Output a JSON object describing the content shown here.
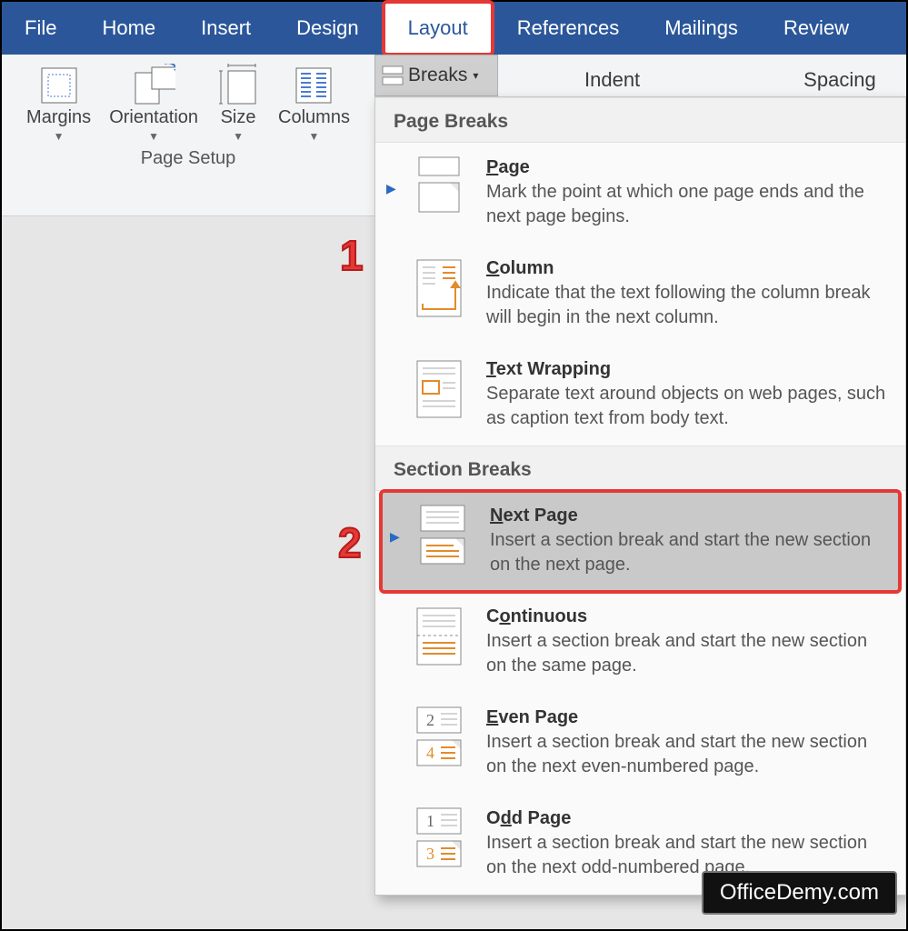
{
  "tabs": [
    "File",
    "Home",
    "Insert",
    "Design",
    "Layout",
    "References",
    "Mailings",
    "Review"
  ],
  "activeTab": "Layout",
  "pageSetup": {
    "buttons": [
      {
        "label": "Margins"
      },
      {
        "label": "Orientation"
      },
      {
        "label": "Size"
      },
      {
        "label": "Columns"
      }
    ],
    "groupLabel": "Page Setup"
  },
  "breaksBtn": "Breaks",
  "rightLabels": [
    "Indent",
    "Spacing"
  ],
  "dropdown": {
    "sections": [
      {
        "title": "Page Breaks",
        "items": [
          {
            "title": "Page",
            "ul": "P",
            "desc": "Mark the point at which one page ends and the next page begins.",
            "arrow": true,
            "icon": "page"
          },
          {
            "title": "Column",
            "ul": "C",
            "desc": "Indicate that the text following the column break will begin in the next column.",
            "icon": "column"
          },
          {
            "title": "Text Wrapping",
            "ul": "T",
            "desc": "Separate text around objects on web pages, such as caption text from body text.",
            "icon": "wrap"
          }
        ]
      },
      {
        "title": "Section Breaks",
        "items": [
          {
            "title": "Next Page",
            "ul": "N",
            "desc": "Insert a section break and start the new section on the next page.",
            "arrow": true,
            "hovered": true,
            "icon": "nextpage"
          },
          {
            "title": "Continuous",
            "ul": "o",
            "desc": "Insert a section break and start the new section on the same page.",
            "icon": "continuous"
          },
          {
            "title": "Even Page",
            "ul": "E",
            "desc": "Insert a section break and start the new section on the next even-numbered page.",
            "icon": "even"
          },
          {
            "title": "Odd Page",
            "ul": "d",
            "desc": "Insert a section break and start the new section on the next odd-numbered page.",
            "icon": "odd"
          }
        ]
      }
    ]
  },
  "callouts": {
    "one": "1",
    "two": "2"
  },
  "watermark": "OfficeDemy.com"
}
